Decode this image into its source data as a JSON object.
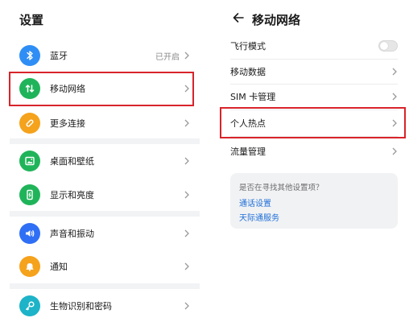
{
  "left": {
    "title": "设置",
    "items": [
      {
        "label": "蓝牙",
        "value": "已开启",
        "icon": "bluetooth-icon",
        "color": "#2f8ef5"
      },
      {
        "label": "移动网络",
        "icon": "mobile-network-icon",
        "color": "#20b45a"
      },
      {
        "label": "更多连接",
        "icon": "link-icon",
        "color": "#f5a21c"
      },
      {
        "label": "桌面和壁纸",
        "icon": "wallpaper-icon",
        "color": "#20b45a"
      },
      {
        "label": "显示和亮度",
        "icon": "display-icon",
        "color": "#20b45a"
      },
      {
        "label": "声音和振动",
        "icon": "sound-icon",
        "color": "#2f6ff5"
      },
      {
        "label": "通知",
        "icon": "bell-icon",
        "color": "#f5a21c"
      },
      {
        "label": "生物识别和密码",
        "icon": "key-icon",
        "color": "#1db3c8"
      }
    ]
  },
  "right": {
    "title": "移动网络",
    "items": [
      {
        "label": "飞行模式",
        "control": "toggle",
        "on": false
      },
      {
        "label": "移动数据"
      },
      {
        "label": "SIM 卡管理"
      },
      {
        "label": "个人热点"
      },
      {
        "label": "流量管理"
      }
    ],
    "suggestion": {
      "question": "是否在寻找其他设置项？",
      "links": [
        "通话设置",
        "天际通服务"
      ]
    }
  },
  "colors": {
    "highlight": "#d9232a",
    "link": "#1e6fd8"
  }
}
